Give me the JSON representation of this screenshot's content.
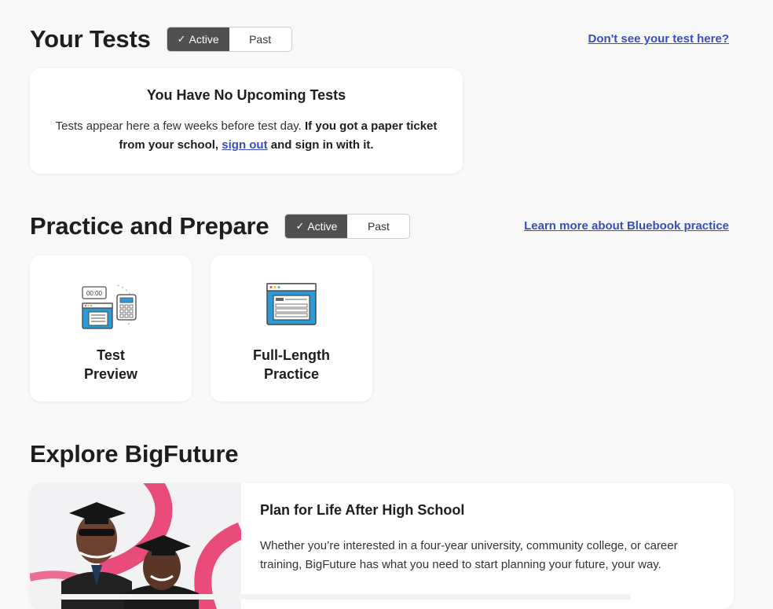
{
  "your_tests": {
    "title": "Your Tests",
    "toggle": {
      "active_label": "Active",
      "past_label": "Past"
    },
    "help_link": "Don't see your test here?",
    "empty_card": {
      "heading": "You Have No Upcoming Tests",
      "text_plain": "Tests appear here a few weeks before test day. ",
      "text_bold_1": "If you got a paper ticket from your school, ",
      "link": "sign out",
      "text_bold_2": " and sign in with it."
    }
  },
  "practice": {
    "title": "Practice and Prepare",
    "toggle": {
      "active_label": "Active",
      "past_label": "Past"
    },
    "help_link": "Learn more about Bluebook practice",
    "cards": [
      {
        "line1": "Test",
        "line2": "Preview",
        "icon": "timer-calculator-icon",
        "timer": "00:00"
      },
      {
        "line1": "Full-Length",
        "line2": "Practice",
        "icon": "browser-document-icon"
      }
    ]
  },
  "explore": {
    "title": "Explore BigFuture",
    "card": {
      "heading": "Plan for Life After High School",
      "body": "Whether you’re interested in a four-year university, community college, or career training, BigFuture has what you need to start planning your future, your way.",
      "image": "graduates-photo"
    }
  },
  "colors": {
    "accent_link": "#3a4dbd",
    "toggle_active": "#505050",
    "icon_blue": "#2b9bd8",
    "photo_pink": "#e94b7a"
  }
}
